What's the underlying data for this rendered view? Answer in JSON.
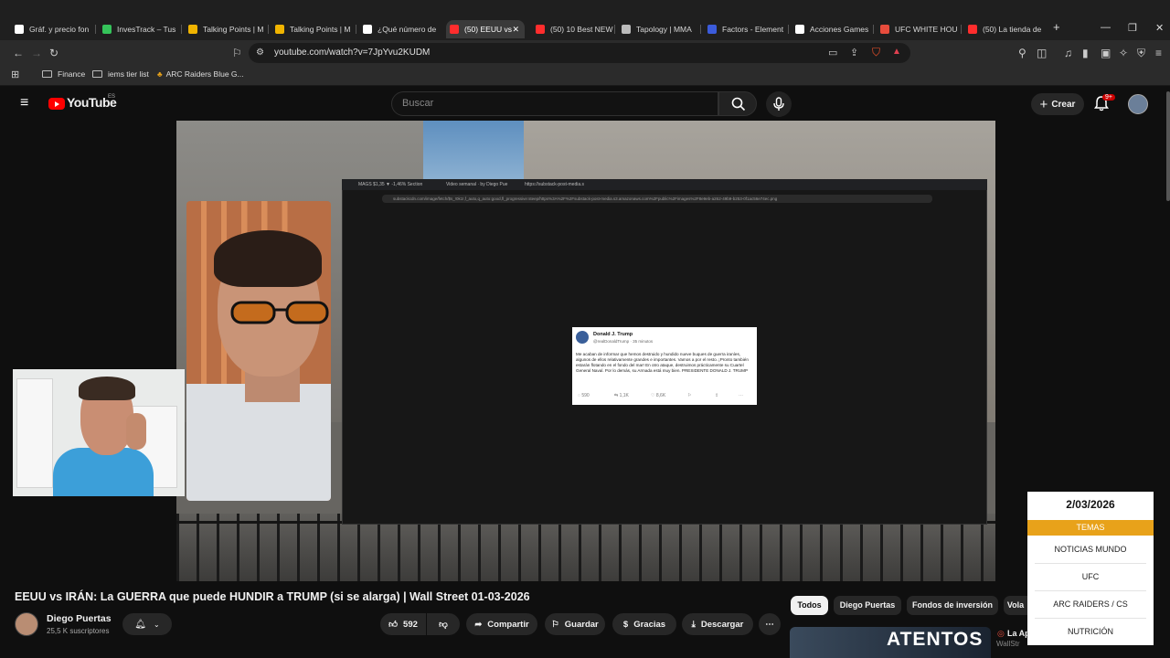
{
  "browser": {
    "tabs": [
      {
        "title": "Gráf. y precio fon",
        "color": "#ffffff",
        "icon": "tv-icon"
      },
      {
        "title": "InvesTrack – Tus",
        "color": "#35c35a",
        "icon": "check-icon"
      },
      {
        "title": "Talking Points | M",
        "color": "#f0b400",
        "icon": "u-icon"
      },
      {
        "title": "Talking Points | M",
        "color": "#f0b400",
        "icon": "u-icon"
      },
      {
        "title": "¿Qué número de",
        "color": "#ffffff",
        "icon": "chat-icon"
      },
      {
        "title": "(50) EEUU vs",
        "color": "#ff2d2d",
        "icon": "youtube-icon"
      },
      {
        "title": "(50) 10 Best NEW",
        "color": "#ff2d2d",
        "icon": "youtube-icon"
      },
      {
        "title": "Tapology | MMA",
        "color": "#bbbbbb",
        "icon": "tapology-icon"
      },
      {
        "title": "Factors - Element",
        "color": "#3b5bdb",
        "icon": "factors-icon"
      },
      {
        "title": "Acciones Games",
        "color": "#ffffff",
        "icon": "inv-icon"
      },
      {
        "title": "UFC WHITE HOU",
        "color": "#e74c3c",
        "icon": "ufc-icon"
      },
      {
        "title": "(50) La tienda de",
        "color": "#ff2d2d",
        "icon": "youtube-icon"
      }
    ],
    "url": "youtube.com/watch?v=7JpYvu2KUDM",
    "shield_count": "10",
    "bookmarks": [
      "Finance",
      "iems tier list",
      "ARC Raiders Blue G..."
    ]
  },
  "youtube": {
    "logo": "YouTube",
    "region": "ES",
    "search_placeholder": "Buscar",
    "create_label": "Crear",
    "notifications": "9+"
  },
  "video": {
    "inner_tabs": [
      "MAGS $1,35 ▼ -1,46% Section",
      "Video semanal · by Diego Pue",
      "https://substack-post-media.s"
    ],
    "inner_url": "substackcdn.com/image/fetch/$s_!0k1!,f_auto,q_auto:good,fl_progressive:steep/https%3A%2F%2Fsubstack-post-media.s3.amazonaws.com%2Fpublic%2Fimages%2F8e9eb-a262-49b9-b253-0f1ac56e74ec.png",
    "tweet": {
      "name": "Donald J. Trump",
      "handle": "@realDonaldTrump · 35 minutos",
      "text": "Me acaban de informar que hemos destruido y hundido nueve buques de guerra iraníes, algunos de ellos relativamente grandes e importantes. Vamos a por el resto. ¡Pronto también estarán flotando en el fondo del mar! En otro ataque, destruimos prácticamente su Cuartel General Naval. Por lo demás, su Armada está muy bien. PRESIDENTE DONALD J. TRUMP",
      "actions": [
        "590",
        "1,1K",
        "8,6K",
        "",
        ""
      ]
    },
    "overlay": {
      "date": "2/03/2026",
      "header": "TEMAS",
      "items": [
        "NOTICIAS MUNDO",
        "UFC",
        "ARC RAIDERS / CS",
        "NUTRICIÓN"
      ]
    }
  },
  "meta": {
    "title": "EEUU vs IRÁN: La GUERRA que puede HUNDIR a TRUMP (si se alarga) | Wall Street 01-03-2026",
    "channel": "Diego Puertas",
    "subscribers": "25,5 K suscriptores",
    "likes": "592",
    "share": "Compartir",
    "save": "Guardar",
    "thanks": "Gracias",
    "download": "Descargar"
  },
  "chips": [
    "Todos",
    "Diego Puertas",
    "Fondos de inversión",
    "Vola"
  ],
  "recommended": {
    "thumb_text": "ATENTOS",
    "title": "La Ap",
    "subtitle": "WallStr"
  }
}
